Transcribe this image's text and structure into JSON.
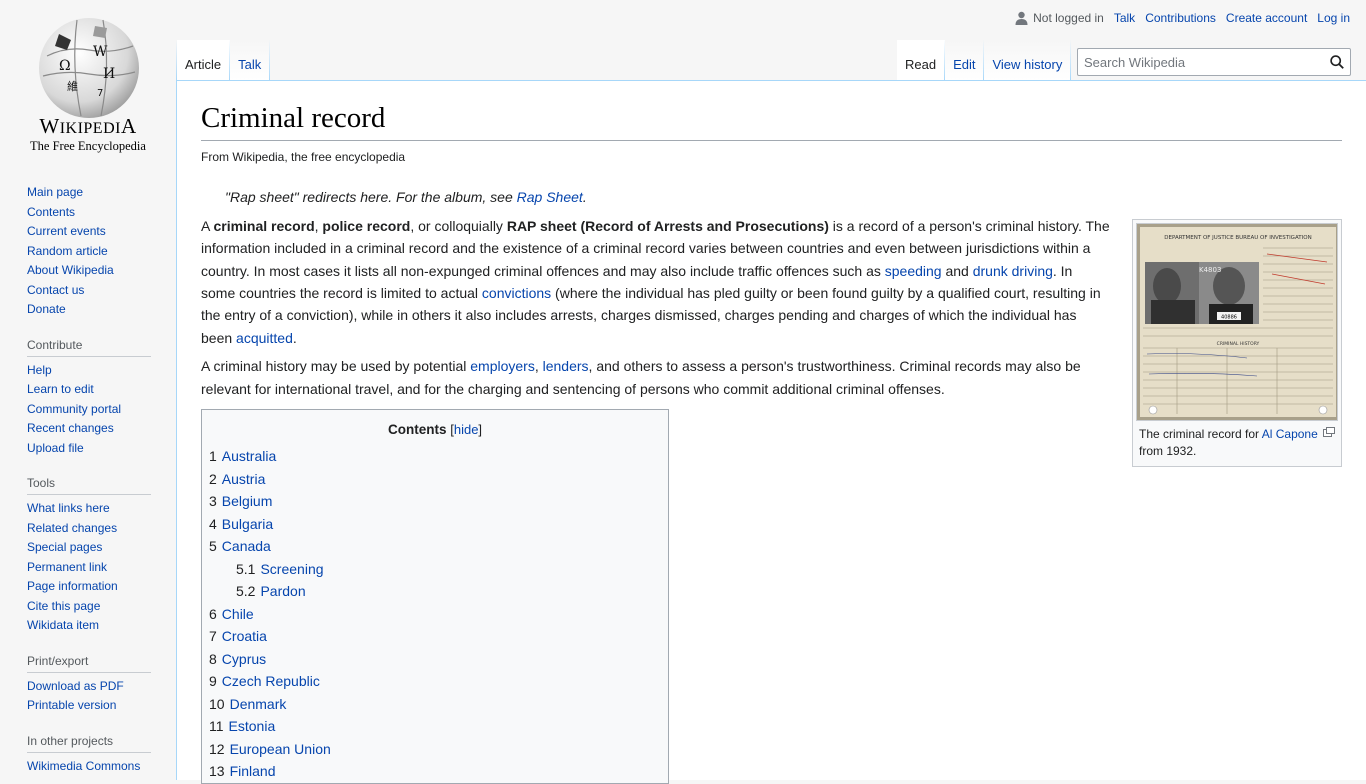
{
  "logo": {
    "wordmark": "Wikipedia",
    "tagline": "The Free Encyclopedia"
  },
  "personal": {
    "not_logged_in": "Not logged in",
    "talk": "Talk",
    "contributions": "Contributions",
    "create_account": "Create account",
    "log_in": "Log in"
  },
  "tabs": {
    "left": [
      {
        "label": "Article",
        "selected": true
      },
      {
        "label": "Talk",
        "selected": false
      }
    ],
    "right": [
      {
        "label": "Read",
        "selected": true
      },
      {
        "label": "Edit",
        "selected": false
      },
      {
        "label": "View history",
        "selected": false
      }
    ]
  },
  "search": {
    "placeholder": "Search Wikipedia"
  },
  "sidebar": {
    "navigation": [
      "Main page",
      "Contents",
      "Current events",
      "Random article",
      "About Wikipedia",
      "Contact us",
      "Donate"
    ],
    "contribute": {
      "heading": "Contribute",
      "items": [
        "Help",
        "Learn to edit",
        "Community portal",
        "Recent changes",
        "Upload file"
      ]
    },
    "tools": {
      "heading": "Tools",
      "items": [
        "What links here",
        "Related changes",
        "Special pages",
        "Permanent link",
        "Page information",
        "Cite this page",
        "Wikidata item"
      ]
    },
    "print": {
      "heading": "Print/export",
      "items": [
        "Download as PDF",
        "Printable version"
      ]
    },
    "projects": {
      "heading": "In other projects",
      "items": [
        "Wikimedia Commons"
      ]
    }
  },
  "article": {
    "title": "Criminal record",
    "site_sub": "From Wikipedia, the free encyclopedia",
    "hatnote_text": "\"Rap sheet\" redirects here. For the album, see ",
    "hatnote_link": "Rap Sheet",
    "hatnote_end": ".",
    "p1": {
      "t0": "A ",
      "b1": "criminal record",
      "t1": ", ",
      "b2": "police record",
      "t2": ", or colloquially ",
      "b3": "RAP sheet (Record of Arrests and Prosecutions)",
      "t3": " is a record of a person's criminal history. The information included in a criminal record and the existence of a criminal record varies between countries and even between jurisdictions within a country. In most cases it lists all non-expunged criminal offences and may also include traffic offences such as ",
      "l1": "speeding",
      "t4": " and ",
      "l2": "drunk driving",
      "t5": ". In some countries the record is limited to actual ",
      "l3": "convictions",
      "t6": " (where the individual has pled guilty or been found guilty by a qualified court, resulting in the entry of a conviction), while in others it also includes arrests, charges dismissed, charges pending and charges of which the individual has been ",
      "l4": "acquitted",
      "t7": "."
    },
    "p2": {
      "t0": "A criminal history may be used by potential ",
      "l1": "employers",
      "t1": ", ",
      "l2": "lenders",
      "t2": ", and others to assess a person's trustworthiness. Criminal records may also be relevant for international travel, and for the charging and sentencing of persons who commit additional criminal offenses."
    },
    "thumb": {
      "caption_pre": "The criminal record for ",
      "caption_link": "Al Capone",
      "caption_post": " from 1932.",
      "card_header": "DEPARTMENT OF JUSTICE BUREAU OF INVESTIGATION",
      "card_number": "K4803",
      "card_plate": "40886",
      "card_section": "CRIMINAL HISTORY"
    },
    "toc": {
      "title": "Contents",
      "hide_open": "[",
      "hide": "hide",
      "hide_close": "]",
      "items": [
        {
          "num": "1",
          "label": "Australia"
        },
        {
          "num": "2",
          "label": "Austria"
        },
        {
          "num": "3",
          "label": "Belgium"
        },
        {
          "num": "4",
          "label": "Bulgaria"
        },
        {
          "num": "5",
          "label": "Canada"
        },
        {
          "num": "5.1",
          "label": "Screening",
          "sub": true
        },
        {
          "num": "5.2",
          "label": "Pardon",
          "sub": true
        },
        {
          "num": "6",
          "label": "Chile"
        },
        {
          "num": "7",
          "label": "Croatia"
        },
        {
          "num": "8",
          "label": "Cyprus"
        },
        {
          "num": "9",
          "label": "Czech Republic"
        },
        {
          "num": "10",
          "label": "Denmark"
        },
        {
          "num": "11",
          "label": "Estonia"
        },
        {
          "num": "12",
          "label": "European Union"
        },
        {
          "num": "13",
          "label": "Finland"
        }
      ]
    }
  }
}
